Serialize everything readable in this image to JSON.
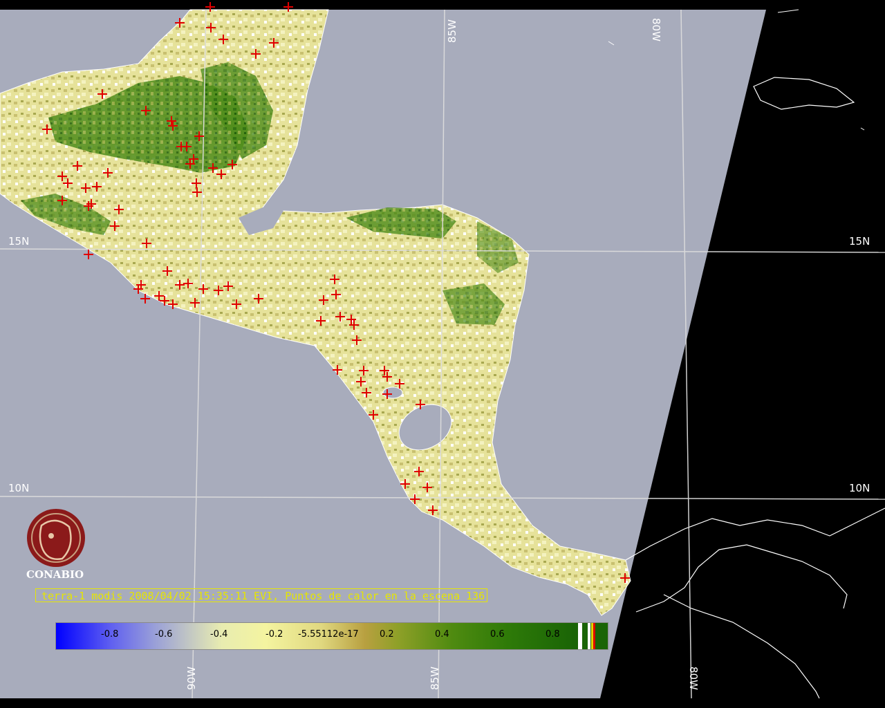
{
  "map": {
    "lat_labels": [
      "15N",
      "10N"
    ],
    "lon_labels_top": [
      "85W",
      "80W"
    ],
    "lon_labels_bottom": [
      "90W",
      "85W",
      "80W"
    ],
    "fire_marker_color": "#e00000",
    "water_color": "#a8acbc",
    "land_low_color": "#ecea98",
    "land_high_color": "#2e7a08",
    "no_data_color": "#000000"
  },
  "logo": {
    "text": "CONABIO",
    "color": "#8b1a1a"
  },
  "caption": "terra-1 modis 2008/04/02 15:35:11 EVI, Puntos de calor en la escena 136",
  "colorbar": {
    "ticks": [
      "-0.8",
      "-0.6",
      "-0.4",
      "-0.2",
      "-5.55112e-17",
      "0.2",
      "0.4",
      "0.6",
      "0.8"
    ]
  }
}
